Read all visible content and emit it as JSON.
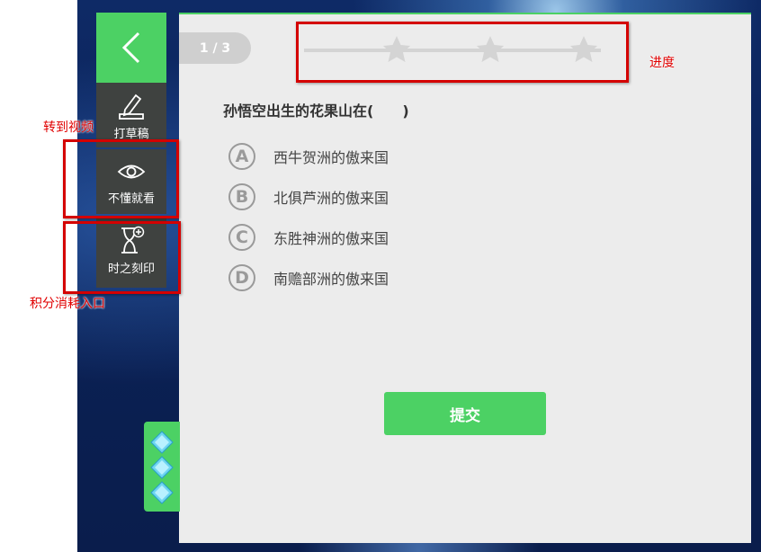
{
  "toolbar": {
    "back_icon": "chevron-left-icon",
    "items": [
      {
        "label": "打草稿",
        "icon": "pencil-icon"
      },
      {
        "label": "不懂就看",
        "icon": "eye-icon"
      },
      {
        "label": "时之刻印",
        "icon": "hourglass-plus-icon"
      }
    ]
  },
  "progress": {
    "label": "1 / 3",
    "current": 1,
    "total": 3
  },
  "question": {
    "text": "孙悟空出生的花果山在(　　)",
    "options": [
      {
        "letter": "A",
        "text": "西牛贺洲的傲来国"
      },
      {
        "letter": "B",
        "text": "北俱芦洲的傲来国"
      },
      {
        "letter": "C",
        "text": "东胜神洲的傲来国"
      },
      {
        "letter": "D",
        "text": "南赡部洲的傲来国"
      }
    ]
  },
  "submit_label": "提交",
  "annotations": {
    "progress": "进度",
    "video": "转到视频",
    "points": "积分消耗入口"
  },
  "colors": {
    "accent": "#4cd164",
    "panel": "#ececec",
    "toolbar": "#3f4240",
    "annotation": "#d40000"
  }
}
